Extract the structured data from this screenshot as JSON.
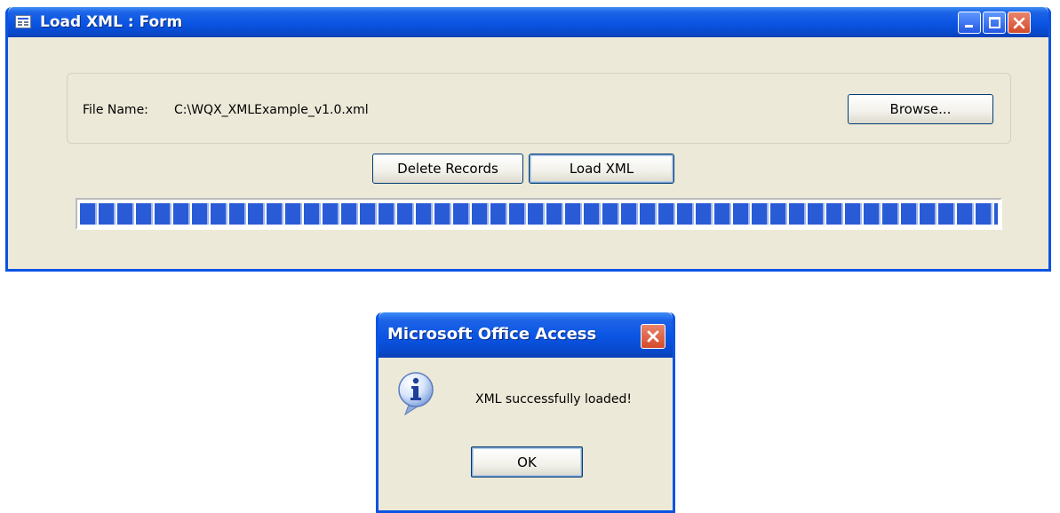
{
  "main_window": {
    "title": "Load XML : Form",
    "file_label": "File Name:",
    "file_path": "C:\\WQX_XMLExample_v1.0.xml",
    "browse_label": "Browse...",
    "delete_label": "Delete Records",
    "load_label": "Load XML",
    "progress_percent": 100
  },
  "dialog": {
    "title": "Microsoft Office Access",
    "message": "XML successfully loaded!",
    "ok_label": "OK",
    "icon": "information-icon"
  },
  "colors": {
    "titlebar_blue": "#0a54e3",
    "form_background": "#ece9d8",
    "progress_blue": "#2a5bd6",
    "close_red": "#d44a2a"
  }
}
